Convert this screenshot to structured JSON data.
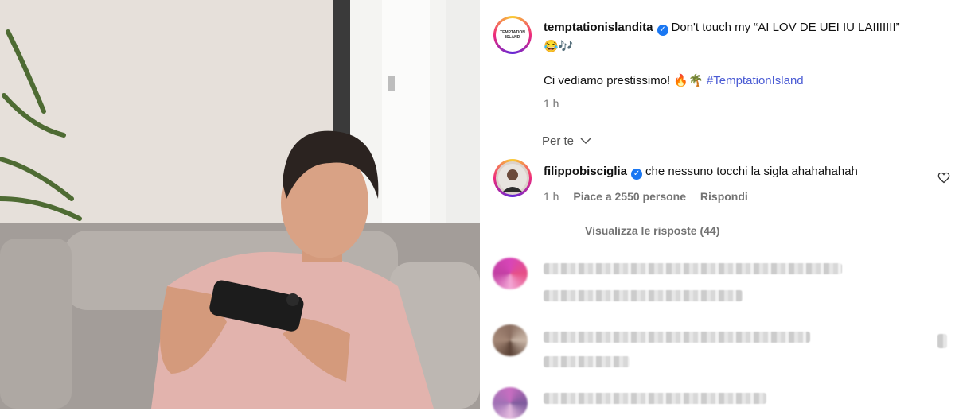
{
  "post": {
    "username": "temptationislandita",
    "caption_line1": "Don't touch my “AI LOV DE UEI IU LAIIIIIII”",
    "caption_emoji": "😂🎶",
    "caption_line2": "Ci vediamo prestissimo! 🔥🌴 ",
    "hashtag": "#TemptationIsland",
    "time": "1 h",
    "logo_text": "TEMPTATION ISLAND"
  },
  "filter": {
    "label": "Per te",
    "icon": "chevron-down-icon"
  },
  "comment": {
    "username": "filippobisciglia",
    "text": "che nessuno tocchi la sigla ahahahahah",
    "time": "1 h",
    "likes": "Piace a 2550 persone",
    "reply": "Rispondi",
    "view_replies": "Visualizza le risposte (44)"
  },
  "colors": {
    "accent": "#1a77f2",
    "hashtag": "#4a5bd4",
    "meta": "#737373"
  }
}
